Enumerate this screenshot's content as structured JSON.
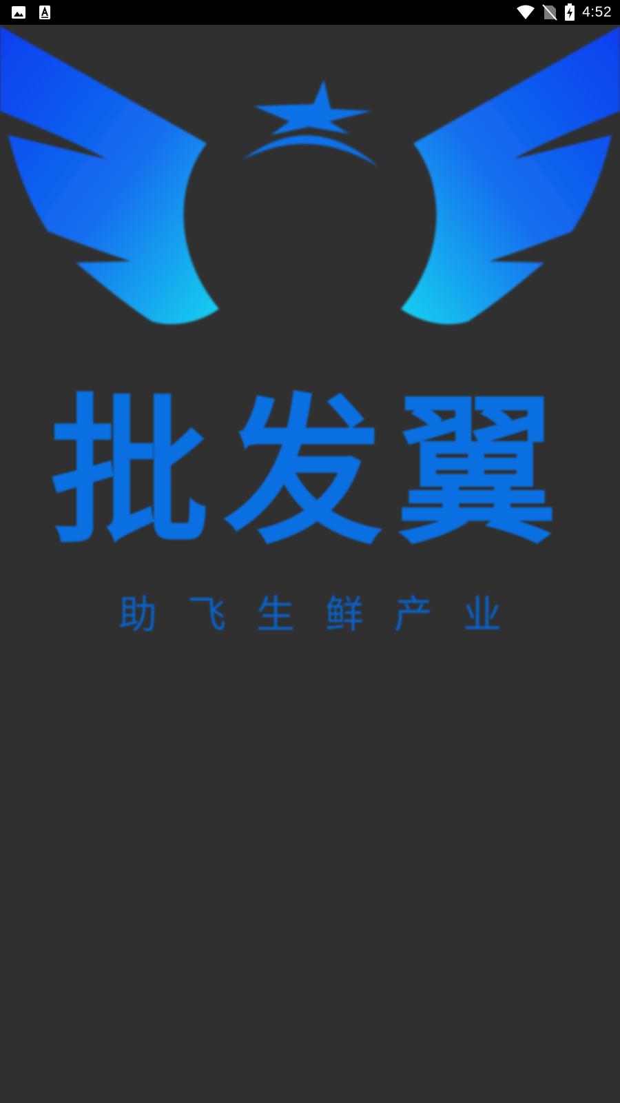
{
  "status_bar": {
    "left_icons": [
      "image-icon",
      "text-icon"
    ],
    "right_icons": [
      "wifi-icon",
      "no-sim-icon",
      "battery-charging-icon"
    ],
    "time": "4:52"
  },
  "splash": {
    "logo": {
      "icon": "winged-star-logo-icon",
      "colors": {
        "wing_top": "#0a3ef0",
        "wing_bottom": "#1ad2f0",
        "star": "#0a72e8"
      }
    },
    "brand_title": "批发翼",
    "slogan": "助飞生鲜产业",
    "colors": {
      "background": "#303030",
      "brand_blue": "#0a6fe0"
    }
  }
}
